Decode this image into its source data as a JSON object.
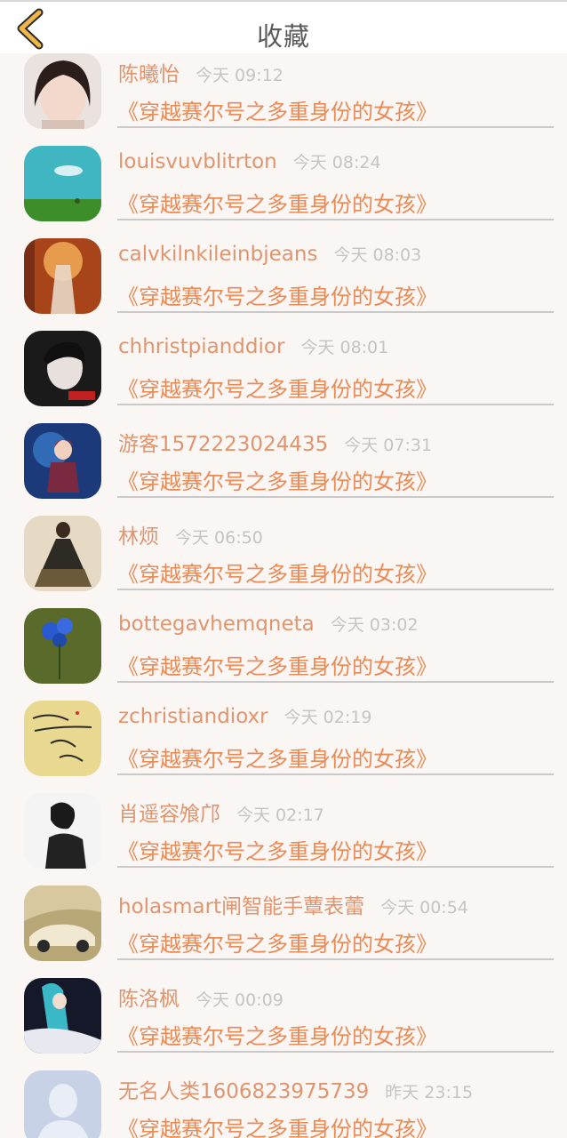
{
  "header": {
    "title": "收藏",
    "back_icon": "chevron-left-icon",
    "back_color": "#f0b64a"
  },
  "items": [
    {
      "name": "陈曦怡",
      "time": "今天 09:12",
      "book": "《穿越赛尔号之多重身份的女孩》"
    },
    {
      "name": "louisvuvblitrton",
      "time": "今天 08:24",
      "book": "《穿越赛尔号之多重身份的女孩》"
    },
    {
      "name": "calvkilnkileinbjeans",
      "time": "今天 08:03",
      "book": "《穿越赛尔号之多重身份的女孩》"
    },
    {
      "name": "chhristpianddior",
      "time": "今天 08:01",
      "book": "《穿越赛尔号之多重身份的女孩》"
    },
    {
      "name": "游客1572223024435",
      "time": "今天 07:31",
      "book": "《穿越赛尔号之多重身份的女孩》"
    },
    {
      "name": "林烦",
      "time": "今天 06:50",
      "book": "《穿越赛尔号之多重身份的女孩》"
    },
    {
      "name": "bottegavhemqneta",
      "time": "今天 03:02",
      "book": "《穿越赛尔号之多重身份的女孩》"
    },
    {
      "name": "zchristiandioxr",
      "time": "今天 02:19",
      "book": "《穿越赛尔号之多重身份的女孩》"
    },
    {
      "name": "肖遥容飧邝",
      "time": "今天 02:17",
      "book": "《穿越赛尔号之多重身份的女孩》"
    },
    {
      "name": "holasmart闸智能手蕈表蕾",
      "time": "今天 00:54",
      "book": "《穿越赛尔号之多重身份的女孩》"
    },
    {
      "name": "陈洛枫",
      "time": "今天 00:09",
      "book": "《穿越赛尔号之多重身份的女孩》"
    },
    {
      "name": "无名人类1606823975739",
      "time": "昨天 23:15",
      "book": "《穿越赛尔号之多重身份的女孩》"
    }
  ]
}
